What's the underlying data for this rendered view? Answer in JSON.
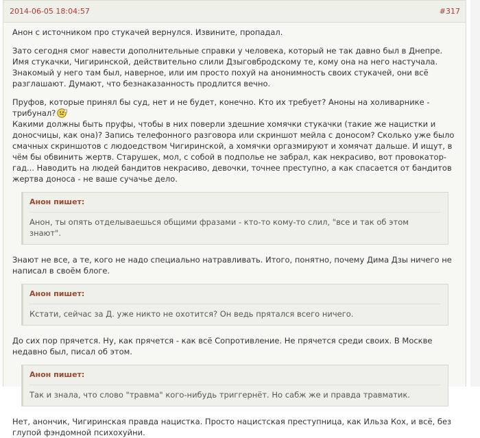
{
  "post": {
    "date": "2014-06-05 18:04:57",
    "number": "#317",
    "paragraphs": [
      "Анон с источником про стукачей вернулся. Извините, пропадал.",
      "Зато сегодня смог навести дополнительные справки у человека, который не так давно был в Днепре. Имя стукачки, Чигиринской, действительно слили Дзыговбродскому те, кому она на него настучала. Знакомый у него там был, наверное, или им просто похуй на анонимность своих стукачей, они всё разглашают. Думают, что безнаказанность продлится вечно.",
      "Пруфов, которые принял бы суд, нет и не будет, конечно. Кто их требует? Аноны на холиварнике - трибунал?",
      "Какими должны быть пруфы, чтобы в них поверли здешние хомячки стукачки (такие же нацистки и доносчицы, как она)? Запись телефонного разговора или скриншот мейла с доносом? Сколько уже было смачных скриншотов с людоедством Чигиринской, а хомячки оргазмируют и хомячат дальше. И ищут, в чём бы обвинить жертв. Старушек, мол, с собой в подполье не забрал, как некрасиво, вот провокатор-гад... Наводить на людей бандитов некрасиво, девочки, точнее преступно, а как спасается от бандитов жертва доноса - не ваше сучачье дело.",
      "Знают не все, а те, кого не надо специально натравливать. Итого, понятно, почему Дима Дзы ничего не написал в своём блоге.",
      "До сих пор прячется. Ну, как прячется - как всё Сопротивление. Не прячется среди своих. В Москве недавно был, писал об этом.",
      "Нет, анончик, Чигиринская правда нацистка. Просто нацистская преступница, как Ильза Кох, и всё, без глупой фэндомной психохуйни."
    ],
    "quotes": [
      {
        "author": "Анон пишет:",
        "text": "Анон, ты опять отделываешься общими фразами - кто-то кому-то слил, \"все и так об этом знают\"."
      },
      {
        "author": "Анон пишет:",
        "text": "Кстати, сейчас за Д. уже никто не охотится? Он ведь прятался всего ничего."
      },
      {
        "author": "Анон пишет:",
        "text": "Так и знала, что слово \"травма\" кого-нибудь триггернёт. Но сабж же и правда травматик."
      }
    ]
  },
  "colors": {
    "accent": "#b03a2e",
    "quote_author": "#9a4a30",
    "quote_bg": "#f0f0ea",
    "post_bg": "#f7f7f4"
  }
}
